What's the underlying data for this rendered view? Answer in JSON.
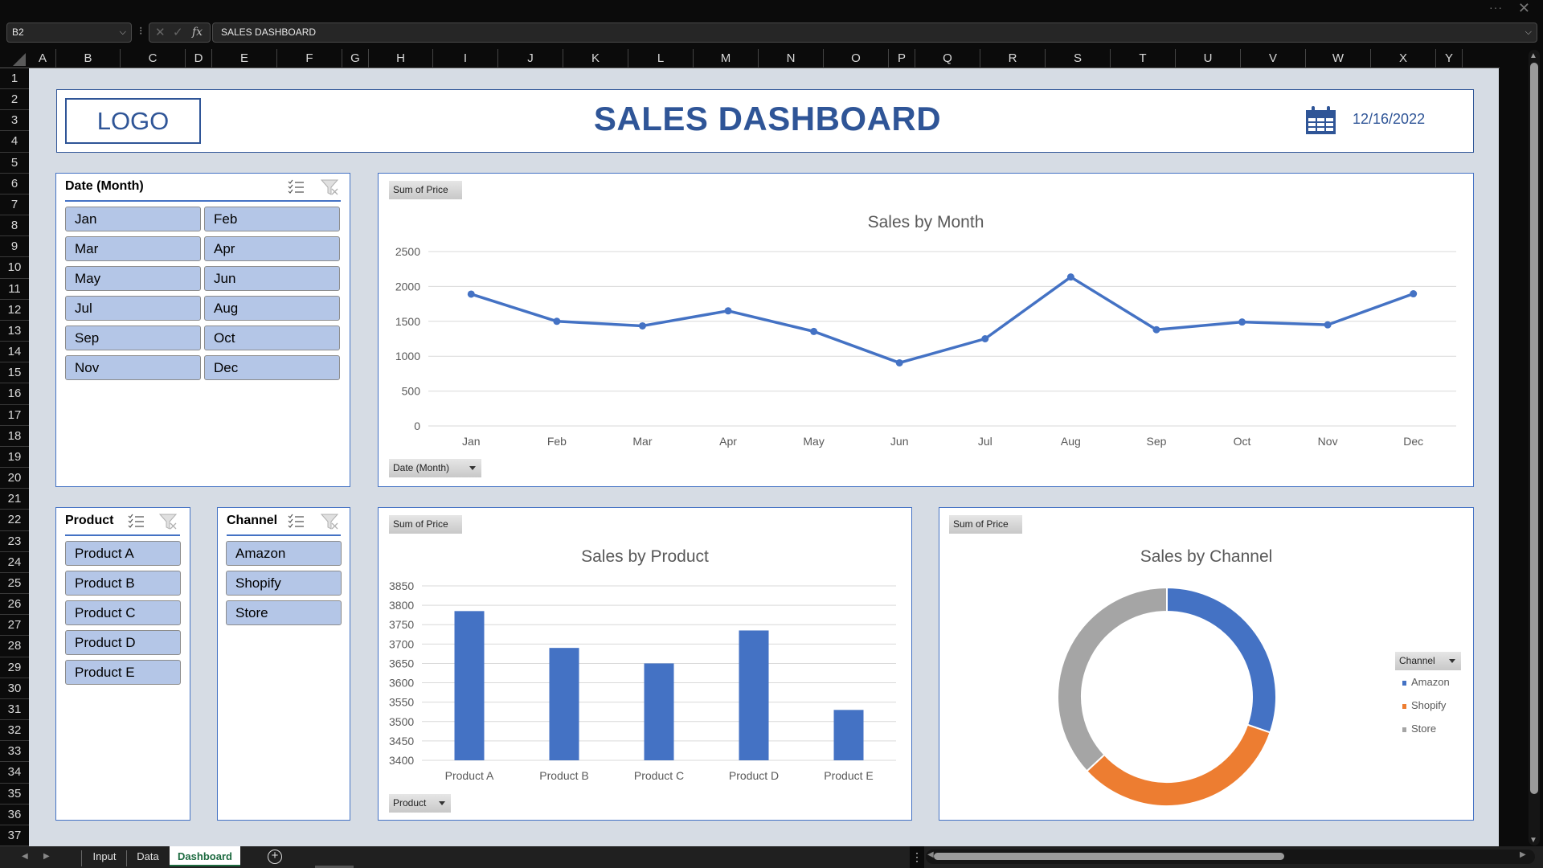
{
  "window": {
    "more_label": "···",
    "close_label": "✕"
  },
  "formula_bar": {
    "name_box": "B2",
    "cancel_icon": "✕",
    "enter_icon": "✓",
    "fx_label": "fx",
    "content": "SALES DASHBOARD"
  },
  "columns": [
    "A",
    "B",
    "C",
    "D",
    "E",
    "F",
    "G",
    "H",
    "I",
    "J",
    "K",
    "L",
    "M",
    "N",
    "O",
    "P",
    "Q",
    "R",
    "S",
    "T",
    "U",
    "V",
    "W",
    "X",
    "Y"
  ],
  "rows": [
    "1",
    "2",
    "3",
    "4",
    "5",
    "6",
    "7",
    "8",
    "9",
    "10",
    "11",
    "12",
    "13",
    "14",
    "15",
    "16",
    "17",
    "18",
    "19",
    "20",
    "21",
    "22",
    "23",
    "24",
    "25",
    "26",
    "27",
    "28",
    "29",
    "30",
    "31",
    "32",
    "33",
    "34",
    "35",
    "36",
    "37"
  ],
  "header": {
    "logo": "LOGO",
    "title": "SALES DASHBOARD",
    "date_icon": "calendar-icon",
    "date": "12/16/2022"
  },
  "slicers": {
    "month": {
      "title": "Date (Month)",
      "items": [
        "Jan",
        "Feb",
        "Mar",
        "Apr",
        "May",
        "Jun",
        "Jul",
        "Aug",
        "Sep",
        "Oct",
        "Nov",
        "Dec"
      ]
    },
    "product": {
      "title": "Product",
      "items": [
        "Product A",
        "Product B",
        "Product C",
        "Product D",
        "Product E"
      ]
    },
    "channel": {
      "title": "Channel",
      "items": [
        "Amazon",
        "Shopify",
        "Store"
      ]
    }
  },
  "charts": {
    "line": {
      "value_button": "Sum of Price",
      "axis_button": "Date  (Month)"
    },
    "bar": {
      "value_button": "Sum of Price",
      "axis_button": "Product"
    },
    "donut": {
      "value_button": "Sum of Price",
      "legend_button": "Channel"
    }
  },
  "chart_data": [
    {
      "type": "line",
      "title": "Sales by Month",
      "categories": [
        "Jan",
        "Feb",
        "Mar",
        "Apr",
        "May",
        "Jun",
        "Jul",
        "Aug",
        "Sep",
        "Oct",
        "Nov",
        "Dec"
      ],
      "series": [
        {
          "name": "Sum of Price",
          "values": [
            1890,
            1500,
            1435,
            1650,
            1355,
            905,
            1250,
            2135,
            1380,
            1490,
            1450,
            1895
          ],
          "color": "#4472c4"
        }
      ],
      "yticks": [
        0,
        500,
        1000,
        1500,
        2000,
        2500
      ],
      "ylim": [
        0,
        2500
      ],
      "xlabel": "",
      "ylabel": "",
      "grid": true,
      "legend": "none"
    },
    {
      "type": "bar",
      "title": "Sales by Product",
      "categories": [
        "Product A",
        "Product B",
        "Product C",
        "Product D",
        "Product E"
      ],
      "values": [
        3785,
        3690,
        3650,
        3735,
        3530
      ],
      "color": "#4472c4",
      "yticks": [
        3400,
        3450,
        3500,
        3550,
        3600,
        3650,
        3700,
        3750,
        3800,
        3850
      ],
      "ylim": [
        3400,
        3850
      ],
      "xlabel": "",
      "ylabel": "",
      "grid": true,
      "legend": "none"
    },
    {
      "type": "pie",
      "variant": "donut",
      "title": "Sales by Channel",
      "categories": [
        "Amazon",
        "Shopify",
        "Store"
      ],
      "values": [
        30.3,
        32.8,
        36.9
      ],
      "units": "percent",
      "colors": [
        "#4472c4",
        "#ed7d31",
        "#a5a5a5"
      ],
      "legend": "right"
    }
  ],
  "sheet_tabs": {
    "tabs": [
      "Input",
      "Data",
      "Dashboard"
    ],
    "active": "Dashboard",
    "add_label": "+"
  }
}
